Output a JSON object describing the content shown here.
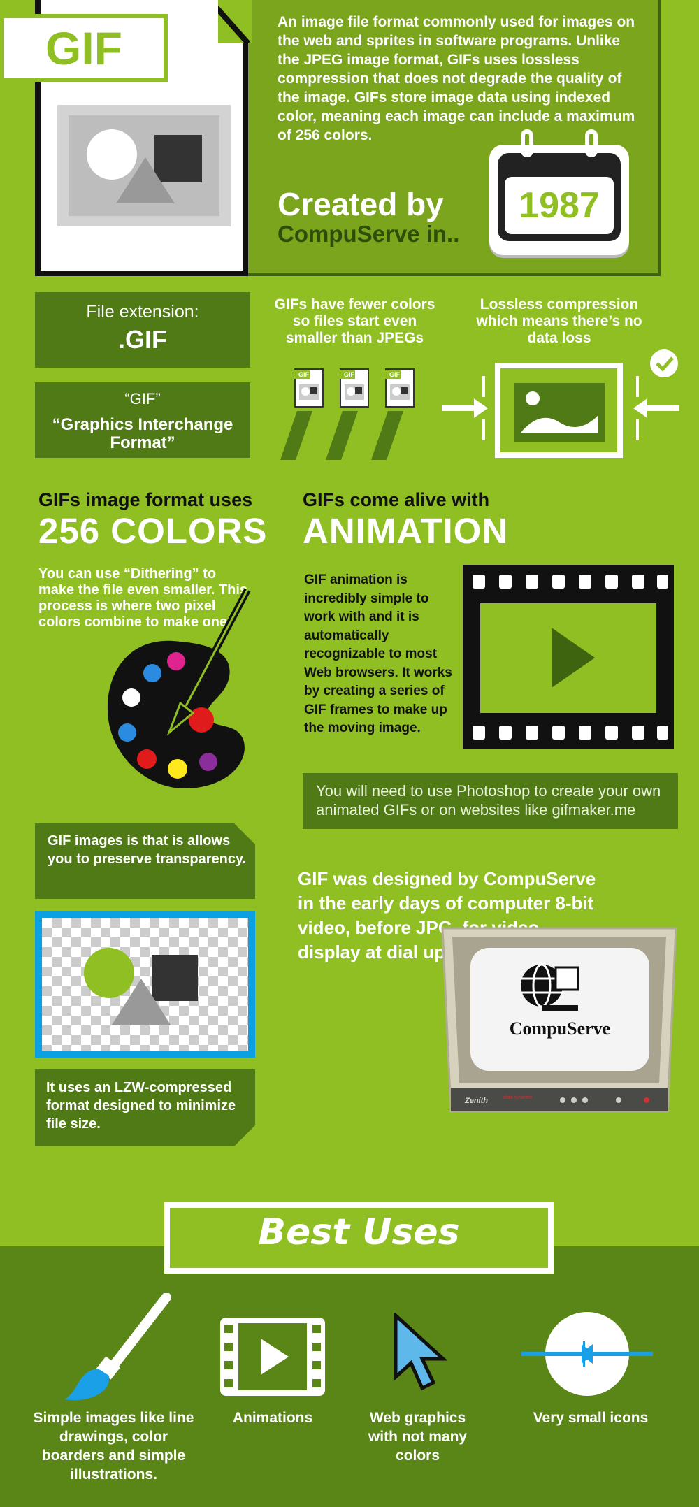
{
  "header": {
    "tag": "GIF",
    "description": "An image file format commonly used for images on the web and sprites in software programs. Unlike the JPEG image format, GIFs uses lossless compression that does not degrade the quality of the image. GIFs store image data using indexed color, meaning each image can include a maximum of 256 colors.",
    "created_by": "Created by",
    "creator": "CompuServe in..",
    "year": "1987"
  },
  "file_info": {
    "extension_label": "File extension:",
    "extension_value": ".GIF",
    "name_quote": "“GIF”",
    "name_full": "“Graphics Interchange Format”",
    "mini_file_tag": "GIF"
  },
  "facts": {
    "fewer_colors": "GIFs have fewer colors so files start even smaller than JPEGs",
    "lossless": "Lossless compression which means there’s no data loss"
  },
  "colors_section": {
    "heading": "GIFs image format uses",
    "title": "256 COLORS",
    "dithering": "You can use “Dithering” to make the file even smaller. This process is where two pixel colors combine to make one."
  },
  "animation_section": {
    "heading": "GIFs come alive with",
    "title": "ANIMATION",
    "description": "GIF animation is incredibly simple to work with and it is automatically recognizable to most Web browsers. It works by creating a series of GIF frames to make up the moving image.",
    "photoshop_note": "You will need to use Photoshop to create your own animated GIFs or on websites like gifmaker.me"
  },
  "transparency": {
    "text": "GIF images is that is allows you to preserve transparency.",
    "lzw": "It uses an LZW-compressed format designed to minimize file size."
  },
  "history": {
    "text": "GIF was designed by CompuServe in the early days of computer 8-bit video, before JPG, for video display at dial up modem speeds.",
    "tv_logo": "CompuServe",
    "tv_brand": "Zenith",
    "tv_sub": "data systems"
  },
  "best_uses": {
    "title": "Best Uses",
    "items": [
      {
        "label": "Simple images like line drawings, color boarders and simple illustrations.",
        "icon": "paintbrush-icon"
      },
      {
        "label": "Animations",
        "icon": "film-play-icon"
      },
      {
        "label": "Web graphics with not many colors",
        "icon": "cursor-icon"
      },
      {
        "label": "Very small icons",
        "icon": "shrink-circle-icon"
      }
    ]
  },
  "colors": {
    "background": "#8fbf22",
    "dark_green": "#4f7a16",
    "accent_blue": "#0aa0e2"
  }
}
